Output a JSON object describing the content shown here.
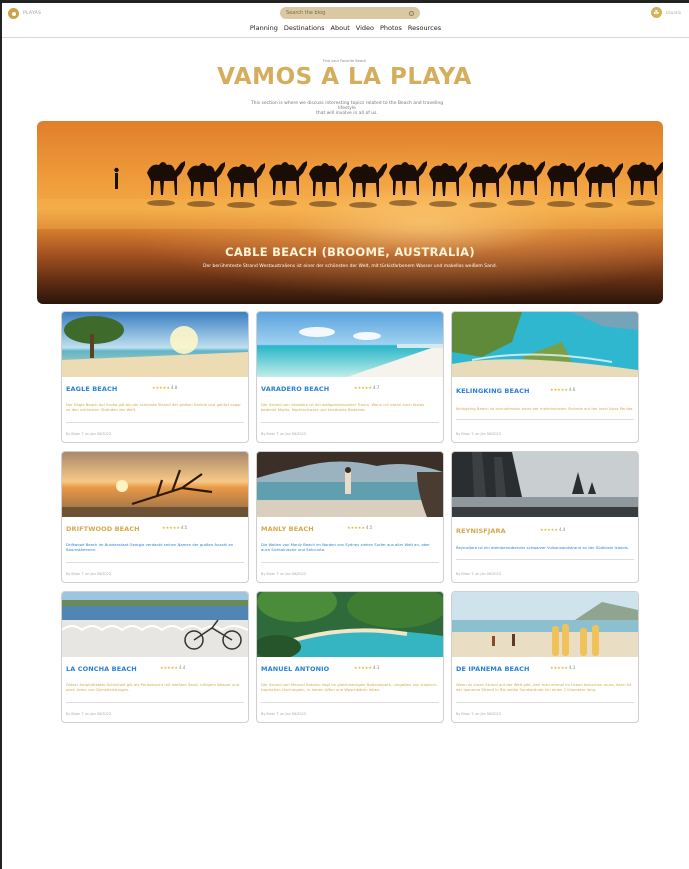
{
  "header": {
    "logo_text": "PLAYAS",
    "search_placeholder": "Search the blog",
    "user_initial": "☘",
    "user_label": "Usuario"
  },
  "nav": [
    "Planning",
    "Destinations",
    "About",
    "Video",
    "Photos",
    "Resources"
  ],
  "hero": {
    "kicker": "Find your Favorite Beach",
    "title": "VAMOS A LA PLAYA",
    "description_line1": "This section is where we discuss interesting topics related to the Beach and traveling lifestyle",
    "description_line2": "that will involve in all of us."
  },
  "banner": {
    "title": "CABLE BEACH (BROOME, AUSTRALIA)",
    "subtitle": "Der berühmteste Strand Westaustraliens ist einer der schönsten der Welt, mit türkisfarbenem Wasser und makellos weißem Sand."
  },
  "cards": [
    {
      "title": "EAGLE BEACH",
      "stars": "★★★★★",
      "rating": "4.8",
      "title_color": "#2a7fd6",
      "desc_color": "#d4a94c",
      "desc": "Der Eagle Beach auf Aruba gilt als der schönste Strand der großen Karibik und gehört sogar zu den schönsten Stränden der Welt.",
      "meta": "By Brian T. on Jan 06/2023"
    },
    {
      "title": "VARADERO BEACH",
      "stars": "★★★★★",
      "rating": "4.7",
      "title_color": "#2a7fd6",
      "desc_color": "#d4a94c",
      "desc": "Der Strand von Varadero ist ein weltgemeinsamer Traum. Wenn ich daran auch etwas bedenkt Mojito, Nachtschwarz und tanzbares Badende.",
      "meta": "By Brian T. on Jan 06/2023"
    },
    {
      "title": "KELINGKING BEACH",
      "stars": "★★★★★",
      "rating": "4.6",
      "title_color": "#2a7fd6",
      "desc_color": "#d4a94c",
      "desc": "Kelingking Beach ist ausnahmslos einer der malerischsten Strände auf der Insel Nusa Penida.",
      "meta": "By Brian T. on Jan 06/2023"
    },
    {
      "title": "DRIFTWOOD BEACH",
      "stars": "★★★★★",
      "rating": "4.5",
      "title_color": "#d4a94c",
      "desc_color": "#2a7fd6",
      "desc": "Driftwood Beach im Bundesstaat Georgia verdankt seinen Namen der großen Anzahl an Baumstämmen.",
      "meta": "By Brian T. on Jan 06/2023"
    },
    {
      "title": "MANLY BEACH",
      "stars": "★★★★★",
      "rating": "4.5",
      "title_color": "#d4a94c",
      "desc_color": "#2a7fd6",
      "desc": "Die Wellen von Manly Beach im Norden von Sydney ziehen Surfer aus aller Welt an, aber auch Sichtalnische und Sehcunto.",
      "meta": "By Brian T. on Jan 06/2023"
    },
    {
      "title": "REYNISFJARA",
      "stars": "★★★★★",
      "rating": "4.4",
      "title_color": "#d4a94c",
      "desc_color": "#2a7fd6",
      "desc": "Reynisfjara ist ein atemberaubender schwarzer Vulkansandstrand an der Südküste Islands.",
      "meta": "By Brian T. on Jan 06/2023"
    },
    {
      "title": "LA CONCHA BEACH",
      "stars": "★★★★★",
      "rating": "4.4",
      "title_color": "#2a7fd6",
      "desc_color": "#d4a94c",
      "desc": "Dieser Amphitheater-Schönheit gilt als Perlenbucht mit weißem Sand, ruhigem Wasser und allen Arten von Dienstleistungen.",
      "meta": "By Brian T. on Jan 06/2023"
    },
    {
      "title": "MANUEL ANTONIO",
      "stars": "★★★★★",
      "rating": "4.3",
      "title_color": "#2a7fd6",
      "desc_color": "#d4a94c",
      "desc": "Der Strand von Manuel Antonio liegt im gleichnamigen Nationalpark, umgeben von tropisch-tropischen Dschungeln, in denen Affen und Waschbären leben.",
      "meta": "By Brian T. on Jan 06/2023"
    },
    {
      "title": "DE IPANEMA BEACH",
      "stars": "★★★★★",
      "rating": "4.3",
      "title_color": "#2a7fd6",
      "desc_color": "#d4a94c",
      "desc": "Wenn es einen Strand auf der Welt gibt, den man einmal im Leben besuchen muss, dann ist der Ipanema Strand in Rio weiße Sandstrände hin einen 2 Kilometer lang.",
      "meta": "By Brian T. on Jan 06/2023"
    }
  ]
}
